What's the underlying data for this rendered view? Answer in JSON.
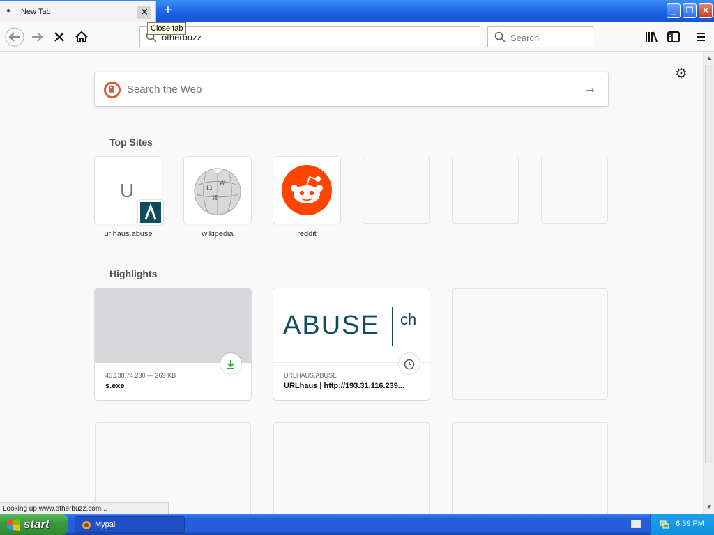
{
  "window": {
    "tab": {
      "title": "New Tab",
      "close_tooltip": "Close tab"
    },
    "new_tab_symbol": "+",
    "controls": {
      "minimize": "_",
      "restore": "❐",
      "close": "✕"
    }
  },
  "toolbar": {
    "url_value": "otherbuzz",
    "search_placeholder": "Search"
  },
  "newtab": {
    "web_search_placeholder": "Search the Web",
    "top_sites_title": "Top Sites",
    "top_sites": [
      {
        "label": "urlhaus.abuse",
        "letter": "U"
      },
      {
        "label": "wikipedia"
      },
      {
        "label": "reddit"
      }
    ],
    "highlights_title": "Highlights",
    "highlights": [
      {
        "meta": "45.138.74.230 — 269 KB",
        "title": "s.exe"
      },
      {
        "meta": "URLHAUS.ABUSE",
        "title": "URLhaus | http://193.31.116.239...",
        "logo_text": "ABUSE",
        "logo_suffix": "ch"
      }
    ]
  },
  "status": {
    "text": "Looking up www.otherbuzz.com..."
  },
  "taskbar": {
    "start_label": "start",
    "task_label": "Mypal",
    "clock": "6:39 PM"
  },
  "colors": {
    "reddit": "#ff4500",
    "abuse_teal": "#0f4c5c",
    "download_green": "#2aa82a",
    "xp_blue": "#245edb"
  }
}
